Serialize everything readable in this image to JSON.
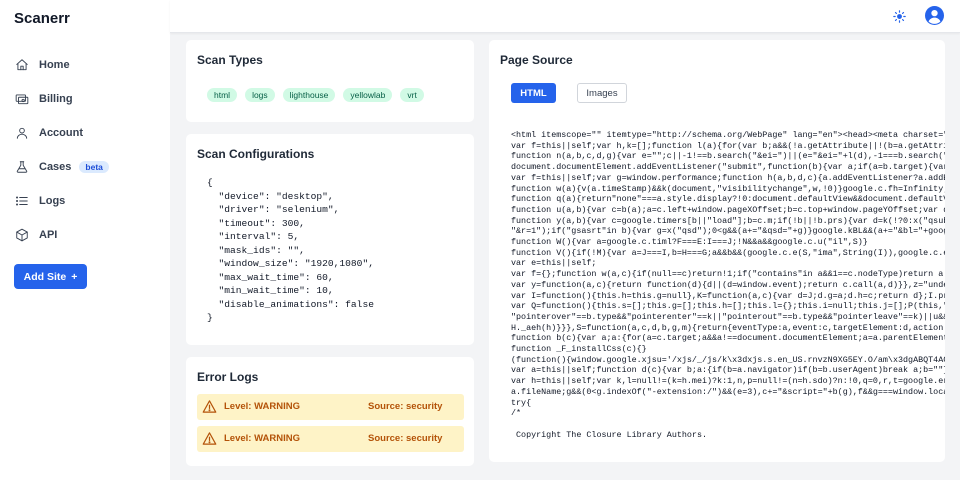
{
  "app": {
    "title": "Scanerr"
  },
  "sidebar": {
    "items": [
      {
        "label": "Home",
        "icon": "home-icon"
      },
      {
        "label": "Billing",
        "icon": "billing-icon"
      },
      {
        "label": "Account",
        "icon": "account-icon"
      },
      {
        "label": "Cases",
        "icon": "cases-icon",
        "badge": "beta"
      },
      {
        "label": "Logs",
        "icon": "list-icon"
      },
      {
        "label": "API",
        "icon": "cube-icon"
      }
    ],
    "add_site_label": "Add Site",
    "add_site_icon": "+"
  },
  "topbar": {
    "theme_icon": "sun-icon",
    "user_icon": "user-circle-icon"
  },
  "scan_types": {
    "title": "Scan Types",
    "tags": [
      "html",
      "logs",
      "lighthouse",
      "yellowlab",
      "vrt"
    ]
  },
  "scan_config": {
    "title": "Scan Configurations",
    "lines": [
      "{",
      "  \"device\": \"desktop\",",
      "  \"driver\": \"selenium\",",
      "  \"timeout\": 300,",
      "  \"interval\": 5,",
      "  \"mask_ids\": \"\",",
      "  \"window_size\": \"1920,1080\",",
      "  \"max_wait_time\": 60,",
      "  \"min_wait_time\": 10,",
      "  \"disable_animations\": false",
      "}"
    ]
  },
  "error_logs": {
    "title": "Error Logs",
    "entries": [
      {
        "level": "Level: WARNING",
        "source": "Source: security"
      },
      {
        "level": "Level: WARNING",
        "source": "Source: security"
      }
    ]
  },
  "page_source": {
    "title": "Page Source",
    "tabs": [
      "HTML",
      "Images"
    ],
    "code_lines": [
      "<html itemscope=\"\" itemtype=\"http://schema.org/WebPage\" lang=\"en\"><head><meta charset=\"U",
      "var f=this||self;var h,k=[];function l(a){for(var b;a&&(!a.getAttribute||!(b=a.getAttrib",
      "function n(a,b,c,d,g){var e=\"\";c||-1!==b.search(\"&ei=\")||(e=\"&ei=\"+l(d),-1===b.search(\"&",
      "document.documentElement.addEventListener(\"submit\",function(b){var a;if(a=b.target){var",
      "var f=this||self;var g=window.performance;function h(a,b,d,c){a.addEventListener?a.addEv",
      "function w(a){v(a.timeStamp)&&k(document,\"visibilitychange\",w,!0)}google.c.fh=Infinity;h",
      "function q(a){return\"none\"===a.style.display?!0:document.defaultView&&document.defaultVi",
      "function u(a,b){var c=b(a);a=c.left+window.pageXOffset;b=c.top+window.pageYOffset;var d=",
      "function y(a,b){var c=google.timers[b||\"load\"];b=c.m;if(!b||!b.prs){var d=k(!?0:x(\"qsubt",
      "\"&r=1\");if(\"gsasrt\"in b){var g=x(\"qsd\");0<g&&(a+=\"&qsd=\"+g)}google.kBL&&(a+=\"&bl=\"+googl",
      "function W(){var a=google.c.timl?F===E:I===J;!N&&a&&google.c.u(\"il\",S)}",
      "function V(){if(!M){var a=J===I,b=H===G;a&&b&&(google.c.e(S,\"ima\",String(I)),google.c.e(",
      "var e=this||self;",
      "var f={};function w(a,c){if(null==c)return!1;if(\"contains\"in a&&1==c.nodeType)return a.",
      "var y=function(a,c){return function(d){d||(d=window.event);return c.call(a,d)}},z=\"undef",
      "var I=function(){this.h=this.g=null},K=function(a,c){var d=J;d.g=a;d.h=c;return d};I.pro",
      "var Q=function(){this.s=[];this.g=[];this.h=[];this.l={};this.i=null;this.j=[];P(this,\"_",
      "\"pointerover\"==b.type&&\"pointerenter\"==k||\"pointerout\"==b.type&&\"pointerleave\"==k)||u&&(",
      "H._aeh(h)}}},S=function(a,c,d,b,g,m){return{eventType:a,event:c,targetElement:d,action:b",
      "function b(c){var a;a:{for(a=c.target;a&&a!==document.documentElement;a=a.parentElement)",
      "function _F_installCss(c){}",
      "(function(){window.google.xjsu='/xjs/_/js/k\\x3dxjs.s.en_US.rnvzN9XG5EY.O/am\\x3dgABQT4ACw",
      "var a=this||self;function d(c){var b;a:{if(b=a.navigator)if(b=b.userAgent)break a;b=\"\"}r",
      "var h=this||self;var k,l=null!=(k=h.mei)?k:1,n,p=null!=(n=h.sdo)?n:!0,q=0,r,t=google.erd",
      "a.fileName;g&&(0<g.indexOf(\"-extension:/\")&&(e=3),c+=\"&script=\"+b(g),f&&g===window.locat",
      "try{",
      "/*",
      "",
      " Copyright The Closure Library Authors."
    ]
  }
}
